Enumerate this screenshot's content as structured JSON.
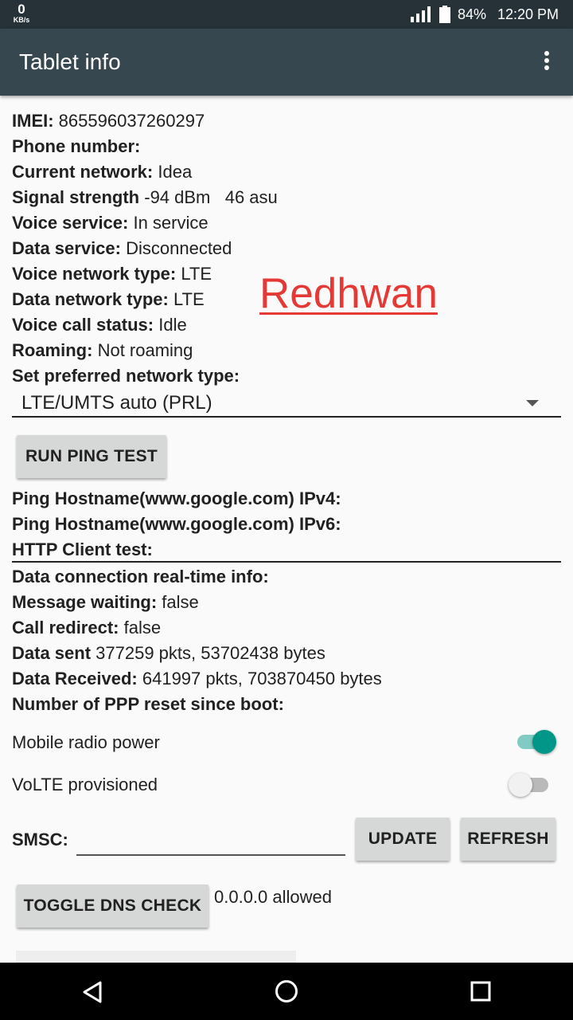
{
  "status_bar": {
    "speed_value": "0",
    "speed_unit": "KB/s",
    "signal_icon": "cellular-signal-icon",
    "battery_icon": "battery-icon",
    "battery_percent": "84%",
    "time": "12:20 PM"
  },
  "app_bar": {
    "title": "Tablet info",
    "overflow_icon": "more-vert-icon"
  },
  "info": {
    "imei_label": "IMEI:",
    "imei_value": " 865596037260297",
    "phone_label": "Phone number:",
    "phone_value": "",
    "network_label": "Current network:",
    "network_value": " Idea",
    "signal_label": "Signal strength",
    "signal_value": " -94 dBm   46 asu",
    "voice_service_label": "Voice service:",
    "voice_service_value": " In service",
    "data_service_label": "Data service:",
    "data_service_value": " Disconnected",
    "voice_type_label": "Voice network type:",
    "voice_type_value": " LTE",
    "data_type_label": "Data network type:",
    "data_type_value": " LTE",
    "call_status_label": "Voice call status:",
    "call_status_value": " Idle",
    "roaming_label": "Roaming:",
    "roaming_value": " Not roaming",
    "preferred_label": "Set preferred network type:"
  },
  "watermark": "Redhwan",
  "preferred_network": {
    "selected": "LTE/UMTS auto (PRL)",
    "arrow_icon": "dropdown-arrow-icon"
  },
  "ping": {
    "button_label": "RUN PING TEST",
    "ipv4_label": "Ping Hostname(www.google.com) IPv4:",
    "ipv6_label": "Ping Hostname(www.google.com) IPv6:",
    "http_label": "HTTP Client test:"
  },
  "data_info": {
    "realtime_label": "Data connection real-time info:",
    "msg_label": "Message waiting:",
    "msg_value": " false",
    "redirect_label": "Call redirect:",
    "redirect_value": " false",
    "sent_label": "Data sent",
    "sent_value": " 377259 pkts, 53702438 bytes",
    "received_label": "Data Received:",
    "received_value": " 641997 pkts, 703870450 bytes",
    "ppp_label": "Number of PPP reset since boot:"
  },
  "toggles": {
    "radio_label": "Mobile radio power",
    "radio_on": true,
    "volte_label": "VoLTE provisioned",
    "volte_on": false,
    "on_color": "#009688",
    "on_track_color": "#80cbc4"
  },
  "smsc": {
    "label": "SMSC:",
    "value": "",
    "update_label": "UPDATE",
    "refresh_label": "REFRESH"
  },
  "dns": {
    "button_label": "TOGGLE DNS CHECK",
    "status": "0.0.0.0 allowed"
  },
  "nav_bar": {
    "back_icon": "back-icon",
    "home_icon": "home-icon",
    "recents_icon": "recents-icon"
  }
}
